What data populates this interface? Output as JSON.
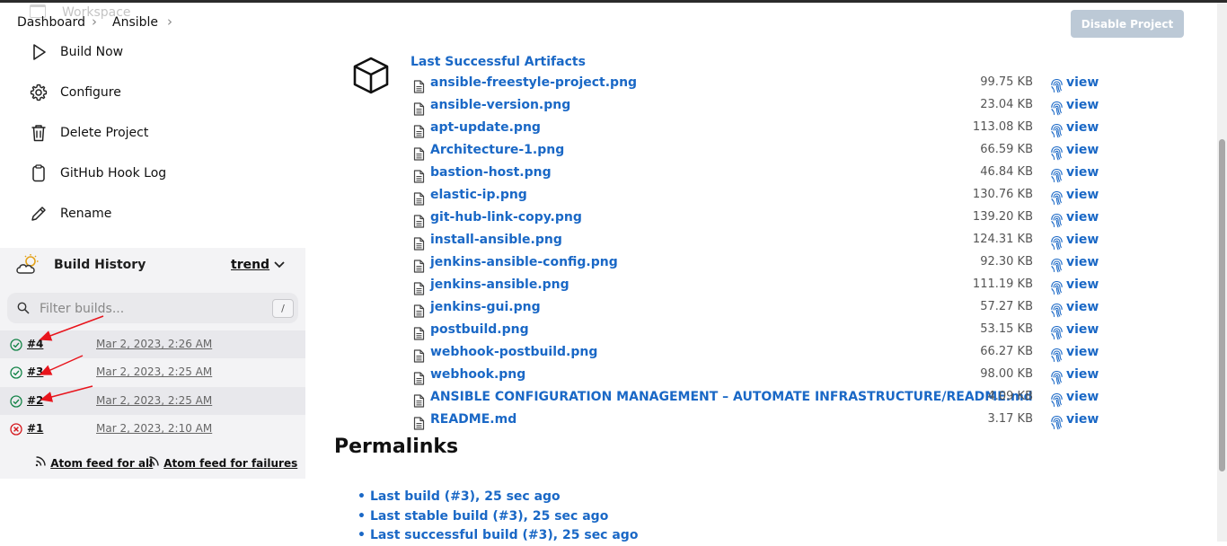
{
  "header": {
    "workspace_ghost": "Workspace",
    "breadcrumbs": [
      "Dashboard",
      "Ansible"
    ],
    "disable_button": "Disable Project"
  },
  "sidebar": {
    "items": [
      {
        "label": "Build Now",
        "icon": "play-icon"
      },
      {
        "label": "Configure",
        "icon": "gear-icon"
      },
      {
        "label": "Delete Project",
        "icon": "trash-icon"
      },
      {
        "label": "GitHub Hook Log",
        "icon": "clipboard-icon"
      },
      {
        "label": "Rename",
        "icon": "pencil-icon"
      }
    ]
  },
  "build_history": {
    "title": "Build History",
    "trend": "trend",
    "filter_placeholder": "Filter builds...",
    "filter_shortcut": "/",
    "builds": [
      {
        "number": "#4",
        "date": "Mar 2, 2023, 2:26 AM",
        "status": "success"
      },
      {
        "number": "#3",
        "date": "Mar 2, 2023, 2:25 AM",
        "status": "success"
      },
      {
        "number": "#2",
        "date": "Mar 2, 2023, 2:25 AM",
        "status": "success"
      },
      {
        "number": "#1",
        "date": "Mar 2, 2023, 2:10 AM",
        "status": "failed"
      }
    ],
    "atom_all": "Atom feed for all",
    "atom_failures": "Atom feed for failures"
  },
  "artifacts": {
    "title": "Last Successful Artifacts",
    "view_label": "view",
    "files": [
      {
        "name": "ansible-freestyle-project.png",
        "size": "99.75 KB"
      },
      {
        "name": "ansible-version.png",
        "size": "23.04 KB"
      },
      {
        "name": "apt-update.png",
        "size": "113.08 KB"
      },
      {
        "name": "Architecture-1.png",
        "size": "66.59 KB"
      },
      {
        "name": "bastion-host.png",
        "size": "46.84 KB"
      },
      {
        "name": "elastic-ip.png",
        "size": "130.76 KB"
      },
      {
        "name": "git-hub-link-copy.png",
        "size": "139.20 KB"
      },
      {
        "name": "install-ansible.png",
        "size": "124.31 KB"
      },
      {
        "name": "jenkins-ansible-config.png",
        "size": "92.30 KB"
      },
      {
        "name": "jenkins-ansible.png",
        "size": "111.19 KB"
      },
      {
        "name": "jenkins-gui.png",
        "size": "57.27 KB"
      },
      {
        "name": "postbuild.png",
        "size": "53.15 KB"
      },
      {
        "name": "webhook-postbuild.png",
        "size": "66.27 KB"
      },
      {
        "name": "webhook.png",
        "size": "98.00 KB"
      },
      {
        "name": "ANSIBLE CONFIGURATION MANAGEMENT – AUTOMATE INFRASTRUCTURE/README.md",
        "size": "4.09 KB"
      },
      {
        "name": "README.md",
        "size": "3.17 KB"
      }
    ]
  },
  "permalinks": {
    "title": "Permalinks",
    "links": [
      "Last build (#3), 25 sec ago",
      "Last stable build (#3), 25 sec ago",
      "Last successful build (#3), 25 sec ago"
    ]
  },
  "colors": {
    "link": "#1a68c6",
    "success": "#138347",
    "failure": "#d5171d",
    "annotation_arrow": "#e8141c"
  }
}
